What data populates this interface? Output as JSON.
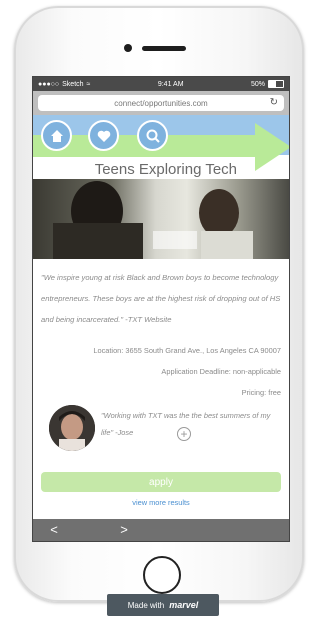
{
  "status": {
    "carrier": "Sketch",
    "time": "9:41 AM",
    "battery": "50%"
  },
  "browser": {
    "url": "connect/opportunities.com",
    "reload_icon": "reload-icon"
  },
  "nav": {
    "home_icon": "home-icon",
    "favorites_icon": "heart-icon",
    "search_icon": "search-icon"
  },
  "page": {
    "title": "Teens Exploring Tech",
    "quote": "\"We inspire young at risk Black and Brown boys to become technology entrepreneurs. These boys are at the highest risk of dropping out of HS and being incarcerated.\" -TXT Website",
    "location": "Location: 3655 South Grand Ave., Los Angeles CA 90007",
    "deadline": "Application Deadline: non-applicable",
    "pricing": "Pricing: free",
    "testimonial": "\"Working with TXT was the the best summers of my life\" -Jose",
    "apply_label": "apply",
    "more_label": "view more results"
  },
  "toolbar": {
    "back_label": "<",
    "forward_label": ">"
  },
  "badge": {
    "text": "Made with",
    "brand": "marvel"
  },
  "colors": {
    "header_band": "#9cc6ea",
    "accent_green": "#b9ea98",
    "apply_button": "#c5e8a8",
    "link_blue": "#4a8fd0"
  }
}
